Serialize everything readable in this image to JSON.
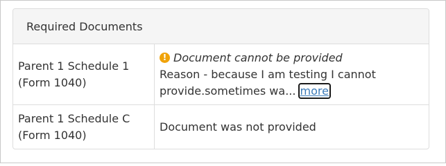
{
  "panel": {
    "title": "Required Documents"
  },
  "rows": [
    {
      "name_line1": "Parent 1 Schedule 1",
      "name_line2": "(Form 1040)",
      "status_title": "Document cannot be provided",
      "reason_line1": "Reason - because I am testing I cannot",
      "reason_line2": "provide.sometimes wa...",
      "more_label": "more"
    },
    {
      "name_line1": "Parent 1 Schedule C",
      "name_line2": "(Form 1040)",
      "status_text": "Document was not provided"
    }
  ],
  "icons": {
    "warning": "exclamation-circle-icon",
    "warning_glyph": "!"
  },
  "colors": {
    "warning": "#f0a30a",
    "link": "#3a7ab8",
    "heading_bg": "#f5f5f5",
    "border": "#dddddd"
  }
}
